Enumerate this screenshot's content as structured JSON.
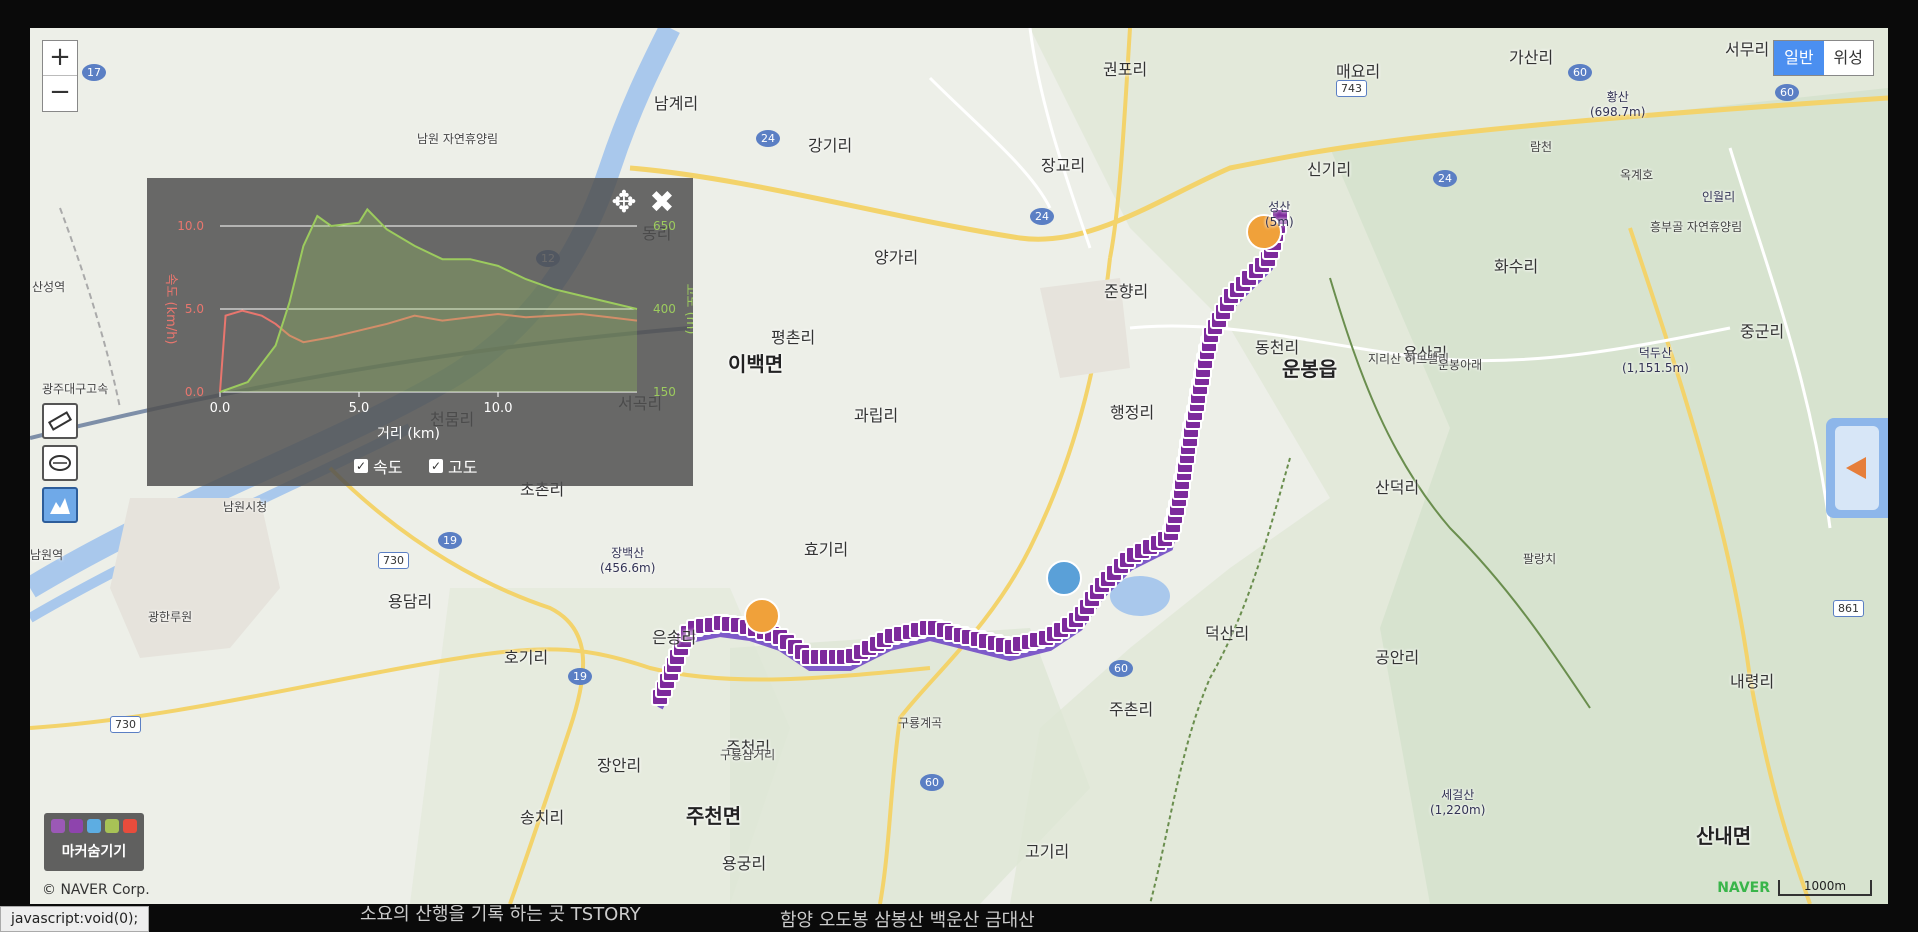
{
  "controls": {
    "zoom_in": "+",
    "zoom_out": "−",
    "maptype_normal": "일반",
    "maptype_satellite": "위성"
  },
  "chart_panel": {
    "move": "✥",
    "close": "✖",
    "check_speed": "속도",
    "check_altitude": "고도"
  },
  "chart_data": {
    "type": "line",
    "xlabel": "거리 (km)",
    "ylabel_left": "속도 (km/h)",
    "ylabel_right": "고도 (m)",
    "x_ticks": [
      "0.0",
      "5.0",
      "10.0"
    ],
    "y_left_ticks": [
      "0.0",
      "5.0",
      "10.0"
    ],
    "y_right_ticks": [
      "150",
      "400",
      "650"
    ],
    "xlim": [
      0,
      15
    ],
    "ylim_left": [
      0,
      10
    ],
    "ylim_right": [
      150,
      650
    ],
    "series": [
      {
        "name": "속도",
        "axis": "left",
        "color": "#e8766e",
        "x": [
          0,
          0.2,
          0.8,
          1.5,
          2.0,
          2.5,
          3.0,
          4.0,
          5.0,
          6.0,
          7.0,
          8.0,
          9.0,
          10.0,
          11.0,
          12.0,
          13.0,
          14.0,
          15.0
        ],
        "y": [
          0,
          4.6,
          4.9,
          4.6,
          4.1,
          3.4,
          3.0,
          3.3,
          3.7,
          4.1,
          4.6,
          4.3,
          4.5,
          4.7,
          4.5,
          4.6,
          4.7,
          4.5,
          4.3
        ]
      },
      {
        "name": "고도",
        "axis": "right",
        "color": "#9ccb5e",
        "x": [
          0,
          1.0,
          2.0,
          2.5,
          3.0,
          3.5,
          4.0,
          5.0,
          5.3,
          6.0,
          7.0,
          8.0,
          9.0,
          10.0,
          11.0,
          12.0,
          13.0,
          14.0,
          15.0
        ],
        "y": [
          150,
          180,
          290,
          420,
          590,
          680,
          650,
          660,
          700,
          640,
          590,
          550,
          550,
          530,
          490,
          460,
          440,
          420,
          400
        ]
      }
    ]
  },
  "map": {
    "labels_big": [
      "이백면",
      "운봉읍",
      "주천면",
      "산내면"
    ],
    "labels": [
      "권포리",
      "매요리",
      "가산리",
      "서무리",
      "남계리",
      "강기리",
      "장교리",
      "신기리",
      "양가리",
      "준향리",
      "화수리",
      "중군리",
      "평촌리",
      "과립리",
      "행정리",
      "동천리",
      "산덕리",
      "효기리",
      "용담리",
      "호기리",
      "은송리",
      "덕산리",
      "공안리",
      "내령리",
      "주촌리",
      "장안리",
      "송치리",
      "용궁리",
      "고기리",
      "주천리",
      "초촌리",
      "서곡리",
      "천뭄리",
      "용산리",
      "동리"
    ],
    "labels_small": [
      "산성역",
      "남원시청",
      "남원역",
      "광한루원",
      "구룡계곡",
      "옥계호",
      "람천",
      "팔랑치",
      "구룡삼거리",
      "흥부골 자연휴양림",
      "지리산 허브밸리",
      "운봉아래",
      "남원 자연휴양림",
      "광주대구고속"
    ],
    "peaks": [
      "황산\n(698.7m)",
      "인월리",
      "덕두산\n(1,151.5m)",
      "장백산\n(456.6m)",
      "세걸산\n(1,220m)",
      "성산\n(5m)"
    ],
    "road_numbers": [
      "17",
      "24",
      "24",
      "24",
      "743",
      "60",
      "19",
      "730",
      "730",
      "19",
      "60",
      "60",
      "60",
      "861",
      "12"
    ]
  },
  "legend_button": "마커숨기기",
  "copyright": "© NAVER Corp.",
  "naver_logo": "NAVER",
  "scale": "1000m",
  "status": "javascript:void(0);",
  "below_text": [
    "소요의 산행을 기록 하는 곳 TSTORY",
    "함양 오도봉 삼봉산 백운산 금대산"
  ]
}
